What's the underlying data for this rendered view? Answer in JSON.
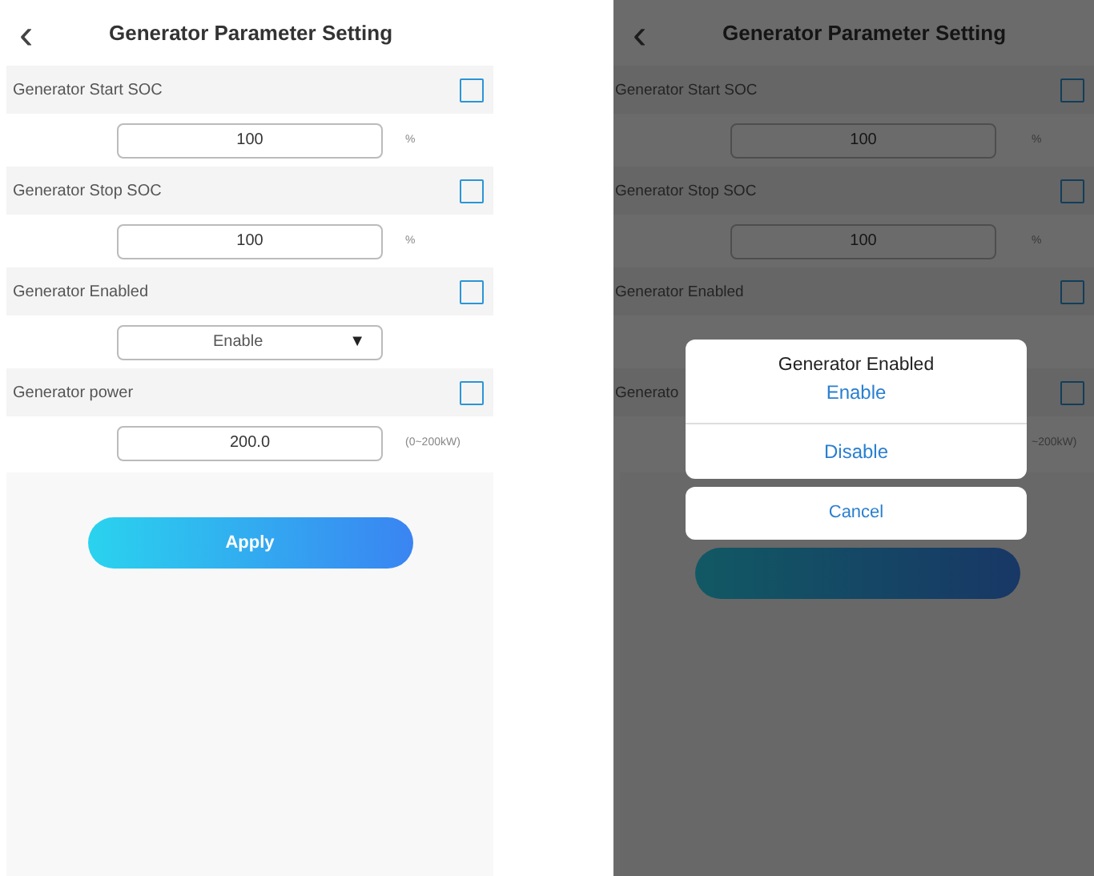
{
  "screens": [
    {
      "back": "‹",
      "title": "Generator Parameter Setting",
      "dimmed": false,
      "rows": [
        {
          "label": "Generator Start SOC",
          "checked": false,
          "control": {
            "kind": "input",
            "value": "100",
            "unit": "%"
          }
        },
        {
          "label": "Generator Stop SOC",
          "checked": false,
          "control": {
            "kind": "input",
            "value": "100",
            "unit": "%"
          }
        },
        {
          "label": "Generator Enabled",
          "checked": false,
          "control": {
            "kind": "select",
            "value": "Enable",
            "arrow": "▼"
          }
        },
        {
          "label": "Generator power",
          "checked": false,
          "control": {
            "kind": "input",
            "value": "200.0",
            "unit": "(0~200kW)"
          }
        }
      ],
      "apply": "Apply"
    },
    {
      "back": "‹",
      "title": "Generator Parameter Setting",
      "dimmed": true,
      "rows": [
        {
          "label": "Generator Start SOC",
          "checked": false,
          "control": {
            "kind": "input",
            "value": "100",
            "unit": "%"
          }
        },
        {
          "label": "Generator Stop SOC",
          "checked": false,
          "control": {
            "kind": "input",
            "value": "100",
            "unit": "%"
          }
        },
        {
          "label": "Generator Enabled",
          "checked": false,
          "control": {
            "kind": "hidden"
          }
        },
        {
          "label": "Generato",
          "checked": false,
          "control": {
            "kind": "hidden",
            "unit": "~200kW)"
          }
        }
      ],
      "sheet": {
        "title": "Generator Enabled",
        "options": [
          "Enable",
          "Disable"
        ],
        "cancel": "Cancel"
      }
    }
  ]
}
